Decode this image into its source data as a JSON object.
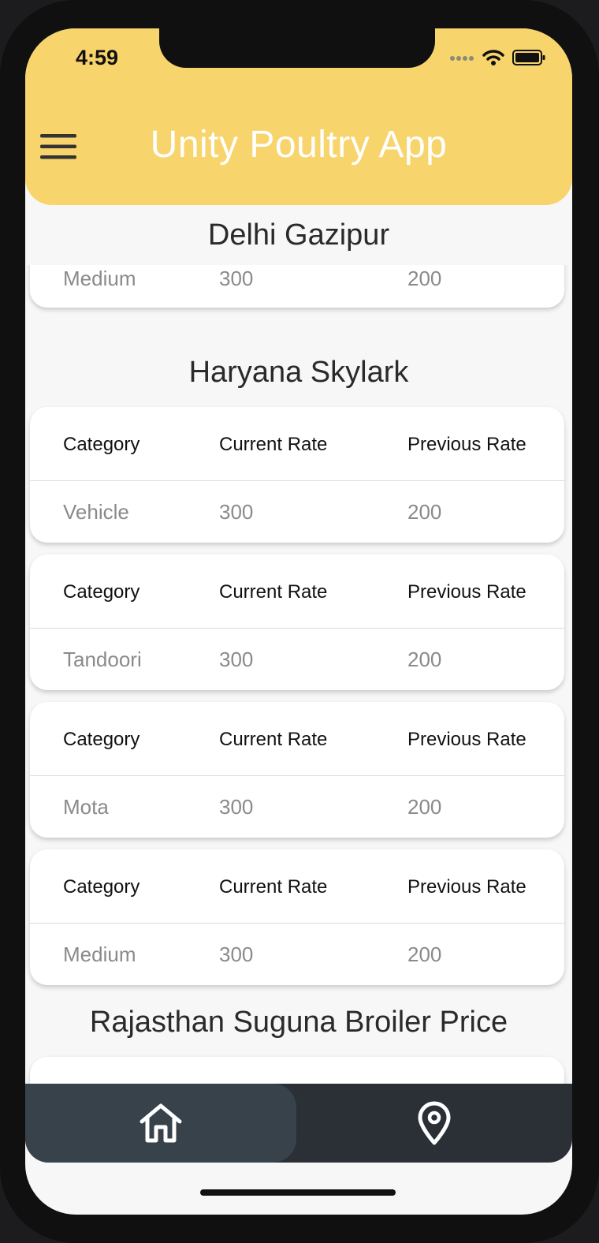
{
  "status_bar": {
    "time": "4:59"
  },
  "app_bar": {
    "title": "Unity Poultry App"
  },
  "sections": [
    {
      "title": "Delhi Gazipur"
    },
    {
      "title": "Haryana Skylark"
    },
    {
      "title": "Rajasthan Suguna Broiler Price"
    }
  ],
  "table_headers": {
    "category": "Category",
    "current_rate": "Current Rate",
    "previous_rate": "Previous Rate"
  },
  "delhi_partial_row": {
    "category": "Medium",
    "current": "300",
    "previous": "200"
  },
  "haryana_rows": [
    {
      "category": "Vehicle",
      "current": "300",
      "previous": "200"
    },
    {
      "category": "Tandoori",
      "current": "300",
      "previous": "200"
    },
    {
      "category": "Mota",
      "current": "300",
      "previous": "200"
    },
    {
      "category": "Medium",
      "current": "300",
      "previous": "200"
    }
  ],
  "bottom_nav": [
    {
      "icon": "home-icon",
      "selected": true
    },
    {
      "icon": "location-pin-icon",
      "selected": false
    }
  ],
  "colors": {
    "app_bar": "#f8d46c",
    "bottom_nav": "#2a3036",
    "bottom_nav_selected": "#37424a",
    "background": "#f7f7f7"
  }
}
